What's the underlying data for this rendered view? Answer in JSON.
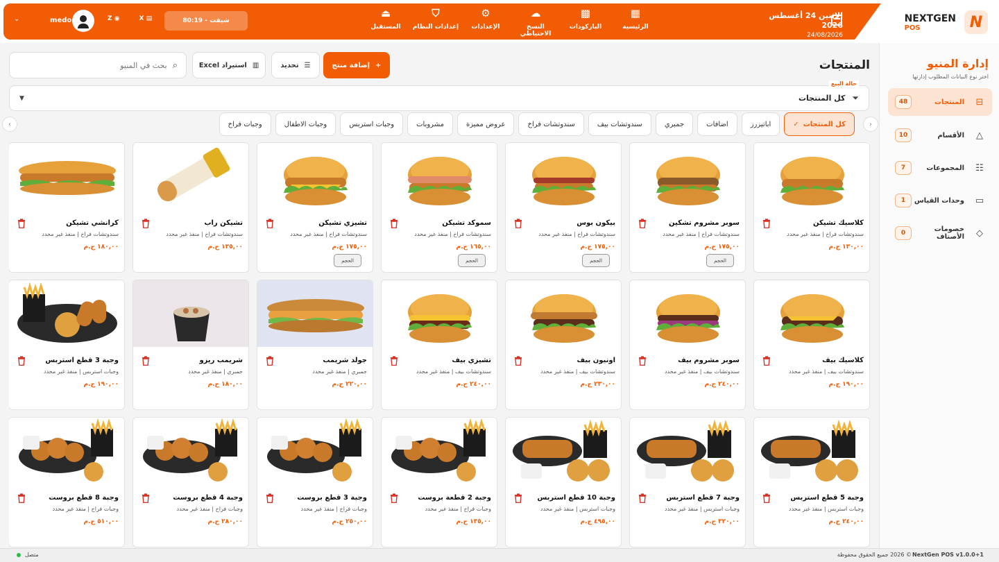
{
  "brand": {
    "name": "NEXTGEN",
    "pos": "POS",
    "logo_letter": "N"
  },
  "header": {
    "date_line1": "الاثنين 24 أغسطس 2026",
    "date_line2": "24/08/2026",
    "nav": [
      {
        "label": "الرئيسية",
        "icon": "grid-icon"
      },
      {
        "label": "الباركودات",
        "icon": "qr-code-icon"
      },
      {
        "label": "النسخ الاحتياطي",
        "icon": "cloud-upload-icon"
      },
      {
        "label": "الإعدادات",
        "icon": "gear-icon"
      },
      {
        "label": "إعدادات النظام",
        "icon": "shield-icon"
      },
      {
        "label": "المستقبل",
        "icon": "bell-icon"
      }
    ],
    "shift": "شيفت - 80:19",
    "x_label": "X",
    "z_label": "Z",
    "user": "medo"
  },
  "sidebar": {
    "title": "إدارة المنيو",
    "subtitle": "اختر نوع البيانات المطلوب إدارتها",
    "items": [
      {
        "label": "المنتجات",
        "count": "48",
        "icon": "archive-icon",
        "active": true
      },
      {
        "label": "الأقسام",
        "count": "10",
        "icon": "shapes-icon",
        "active": false
      },
      {
        "label": "المجموعات",
        "count": "7",
        "icon": "sliders-icon",
        "active": false
      },
      {
        "label": "وحدات القياس",
        "count": "1",
        "icon": "ruler-icon",
        "active": false
      },
      {
        "label": "خصومات الأصناف",
        "count": "0",
        "icon": "tag-icon",
        "active": false
      }
    ]
  },
  "toolbar": {
    "page_title": "المنتجات",
    "add_label": "إضافة منتج",
    "select_label": "تحديد",
    "import_label": "استيراد Excel",
    "search_placeholder": "بحث في المنيو"
  },
  "filter": {
    "label": "حالة البيع",
    "value": "كل المنتجات"
  },
  "categories": [
    {
      "label": "كل المنتجات",
      "active": true
    },
    {
      "label": "اباتيزرز",
      "active": false
    },
    {
      "label": "اضافات",
      "active": false
    },
    {
      "label": "جمبري",
      "active": false
    },
    {
      "label": "سندوتشات بيف",
      "active": false
    },
    {
      "label": "سندوتشات فراخ",
      "active": false
    },
    {
      "label": "عروض مميزة",
      "active": false
    },
    {
      "label": "مشروبات",
      "active": false
    },
    {
      "label": "وجبات استربس",
      "active": false
    },
    {
      "label": "وجبات الاطفال",
      "active": false
    },
    {
      "label": "وجبات فراخ",
      "active": false
    }
  ],
  "products": [
    {
      "name": "كلاسيك تشيكن",
      "sub": "سندوتشات فراخ | منفذ غير محدد",
      "price": "١٣٠,٠٠ ج.م",
      "tag": "",
      "img": "chicken-burger",
      "bg": "#ffffff"
    },
    {
      "name": "سوبر مشروم تشكين",
      "sub": "سندوتشات فراخ | منفذ غير محدد",
      "price": "١٧٥,٠٠ ج.م",
      "tag": "الحجم",
      "img": "mushroom-chicken",
      "bg": "#ffffff"
    },
    {
      "name": "بيكون بوس",
      "sub": "سندوتشات فراخ | منفذ غير محدد",
      "price": "١٧٥,٠٠ ج.م",
      "tag": "الحجم",
      "img": "bacon-burger",
      "bg": "#ffffff"
    },
    {
      "name": "سموكد تشيكن",
      "sub": "سندوتشات فراخ | منفذ غير محدد",
      "price": "١٦٥,٠٠ ج.م",
      "tag": "الحجم",
      "img": "smoked-chicken",
      "bg": "#ffffff"
    },
    {
      "name": "تشيزي تشيكن",
      "sub": "سندوتشات فراخ | منفذ غير محدد",
      "price": "١٧٥,٠٠ ج.م",
      "tag": "الحجم",
      "img": "cheesy-chicken",
      "bg": "#ffffff"
    },
    {
      "name": "تشيكن راب",
      "sub": "سندوتشات فراخ | منفذ غير محدد",
      "price": "١٣٥,٠٠ ج.م",
      "tag": "",
      "img": "chicken-wrap",
      "bg": "#ffffff"
    },
    {
      "name": "كرانشي تشيكن",
      "sub": "سندوتشات فراخ | منفذ غير محدد",
      "price": "١٨٠,٠٠ ج.م",
      "tag": "",
      "img": "sub-sandwich",
      "bg": "#ffffff"
    },
    {
      "name": "كلاسيك بيف",
      "sub": "سندوتشات بيف | منفذ غير محدد",
      "price": "١٩٠,٠٠ ج.م",
      "tag": "",
      "img": "beef-burger",
      "bg": "#ffffff"
    },
    {
      "name": "سوبر مشروم بيف",
      "sub": "سندوتشات بيف | منفذ غير محدد",
      "price": "٢٤٠,٠٠ ج.م",
      "tag": "",
      "img": "beef-onion",
      "bg": "#ffffff"
    },
    {
      "name": "اونيون بيف",
      "sub": "سندوتشات بيف | منفذ غير محدد",
      "price": "٢٣٠,٠٠ ج.م",
      "tag": "",
      "img": "onion-beef",
      "bg": "#ffffff"
    },
    {
      "name": "تشيزي بيف",
      "sub": "سندوتشات بيف | منفذ غير محدد",
      "price": "٢٤٠,٠٠ ج.م",
      "tag": "",
      "img": "cheesy-beef",
      "bg": "#ffffff"
    },
    {
      "name": "جولد شريمب",
      "sub": "جمبري | منفذ غير محدد",
      "price": "٢٢٠,٠٠ ج.م",
      "tag": "",
      "img": "shrimp-sub",
      "bg": "#dfe3f2"
    },
    {
      "name": "شريمب ريزو",
      "sub": "جمبري | منفذ غير محدد",
      "price": "١٨٠,٠٠ ج.م",
      "tag": "",
      "img": "shrimp-bowl",
      "bg": "#ece6ea"
    },
    {
      "name": "وجبة 3 قطع استربس",
      "sub": "وجبات استربس | منفذ غير محدد",
      "price": "١٩٠,٠٠ ج.م",
      "tag": "",
      "img": "strips-meal",
      "bg": "#ffffff"
    },
    {
      "name": "وجبة 5 قطع استربس",
      "sub": "وجبات استربس | منفذ غير محدد",
      "price": "٢٤٠,٠٠ ج.م",
      "tag": "",
      "img": "strips-basket",
      "bg": "#ffffff"
    },
    {
      "name": "وجبة 7 قطع استربس",
      "sub": "وجبات استربس | منفذ غير محدد",
      "price": "٣٢٠,٠٠ ج.م",
      "tag": "",
      "img": "strips-basket",
      "bg": "#ffffff"
    },
    {
      "name": "وجبة 10 قطع استربس",
      "sub": "وجبات استربس | منفذ غير محدد",
      "price": "٤٩٥,٠٠ ج.م",
      "tag": "",
      "img": "strips-basket",
      "bg": "#ffffff"
    },
    {
      "name": "وجبة 2 قطعة بروست",
      "sub": "وجبات فراخ | منفذ غير محدد",
      "price": "١٣٥,٠٠ ج.م",
      "tag": "",
      "img": "broast-basket",
      "bg": "#ffffff"
    },
    {
      "name": "وجبة 3 قطع بروست",
      "sub": "وجبات فراخ | منفذ غير محدد",
      "price": "٢٥٠,٠٠ ج.م",
      "tag": "",
      "img": "broast-basket",
      "bg": "#ffffff"
    },
    {
      "name": "وجبة 4 قطع بروست",
      "sub": "وجبات فراخ | منفذ غير محدد",
      "price": "٢٨٠,٠٠ ج.م",
      "tag": "",
      "img": "broast-basket",
      "bg": "#ffffff"
    },
    {
      "name": "وجبة 8 قطع بروست",
      "sub": "وجبات فراخ | منفذ غير محدد",
      "price": "٥١٠,٠٠ ج.م",
      "tag": "",
      "img": "broast-basket",
      "bg": "#ffffff"
    }
  ],
  "footer": {
    "version": "NextGen POS v1.0.0+1",
    "copyright": "© 2026 جميع الحقوق محفوظة",
    "status": "متصل"
  },
  "colors": {
    "accent": "#f25c05",
    "accent_light": "#fde3d2",
    "online": "#2eb84f",
    "delete": "#d93025"
  }
}
